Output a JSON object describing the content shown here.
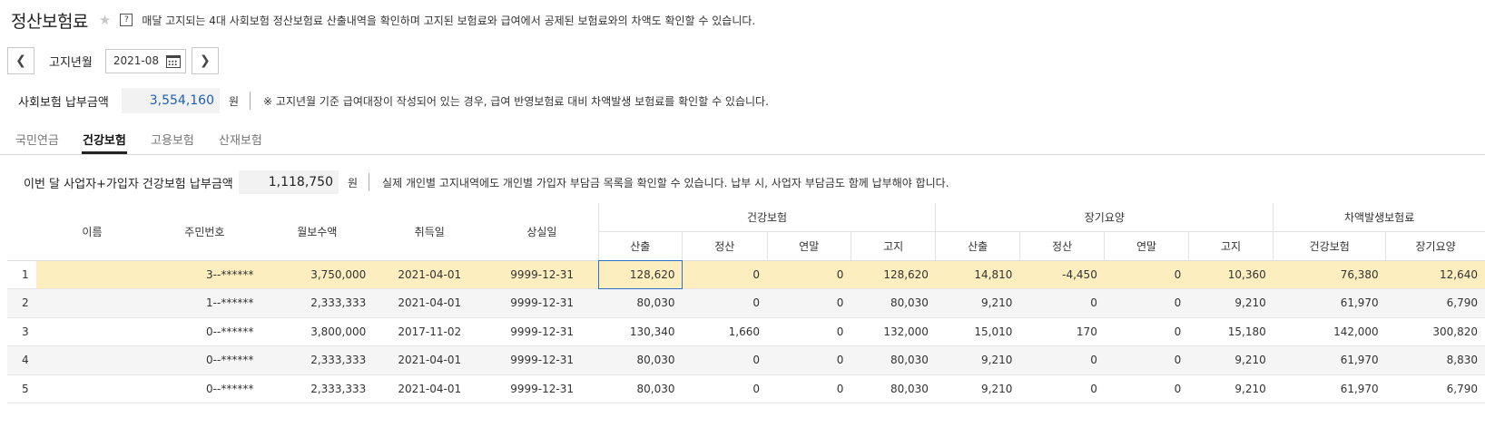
{
  "header": {
    "title": "정산보험료",
    "description": "매달 고지되는 4대 사회보험 정산보험료 산출내역을 확인하며 고지된 보험료와 급여에서 공제된 보험료와의 차액도 확인할 수 있습니다."
  },
  "date_nav": {
    "label": "고지년월",
    "value": "2021-08"
  },
  "total": {
    "label": "사회보험 납부금액",
    "value": "3,554,160",
    "unit": "원",
    "note": "※ 고지년월 기준 급여대장이 작성되어 있는 경우, 급여 반영보험료 대비 차액발생 보험료를 확인할 수 있습니다."
  },
  "tabs": [
    "국민연금",
    "건강보험",
    "고용보험",
    "산재보험"
  ],
  "active_tab": "건강보험",
  "sub_total": {
    "label": "이번 달 사업자+가입자 건강보험 납부금액",
    "value": "1,118,750",
    "unit": "원",
    "note": "실제 개인별 고지내역에도 개인별 가입자 부담금 목록을 확인할 수 있습니다. 납부 시, 사업자 부담금도 함께 납부해야 합니다."
  },
  "table": {
    "columns": {
      "name": "이름",
      "ssn": "주민번호",
      "salary": "월보수액",
      "acquired": "취득일",
      "lost": "상실일",
      "health_group": "건강보험",
      "longterm_group": "장기요양",
      "diff_group": "차액발생보험료",
      "calc": "산출",
      "settle": "정산",
      "yearend": "연말",
      "notice": "고지",
      "diff_health": "건강보험",
      "diff_longterm": "장기요양"
    },
    "rows": [
      {
        "no": "1",
        "name": "",
        "ssn": "3--******",
        "salary": "3,750,000",
        "acquired": "2021-04-01",
        "lost": "9999-12-31",
        "h_calc": "128,620",
        "h_settle": "0",
        "h_year": "0",
        "h_notice": "128,620",
        "l_calc": "14,810",
        "l_settle": "-4,450",
        "l_year": "0",
        "l_notice": "10,360",
        "d_health": "76,380",
        "d_long": "12,640"
      },
      {
        "no": "2",
        "name": "",
        "ssn": "1--******",
        "salary": "2,333,333",
        "acquired": "2021-04-01",
        "lost": "9999-12-31",
        "h_calc": "80,030",
        "h_settle": "0",
        "h_year": "0",
        "h_notice": "80,030",
        "l_calc": "9,210",
        "l_settle": "0",
        "l_year": "0",
        "l_notice": "9,210",
        "d_health": "61,970",
        "d_long": "6,790"
      },
      {
        "no": "3",
        "name": "",
        "ssn": "0--******",
        "salary": "3,800,000",
        "acquired": "2017-11-02",
        "lost": "9999-12-31",
        "h_calc": "130,340",
        "h_settle": "1,660",
        "h_year": "0",
        "h_notice": "132,000",
        "l_calc": "15,010",
        "l_settle": "170",
        "l_year": "0",
        "l_notice": "15,180",
        "d_health": "142,000",
        "d_long": "300,820"
      },
      {
        "no": "4",
        "name": "",
        "ssn": "0--******",
        "salary": "2,333,333",
        "acquired": "2021-04-01",
        "lost": "9999-12-31",
        "h_calc": "80,030",
        "h_settle": "0",
        "h_year": "0",
        "h_notice": "80,030",
        "l_calc": "9,210",
        "l_settle": "0",
        "l_year": "0",
        "l_notice": "9,210",
        "d_health": "61,970",
        "d_long": "8,830"
      },
      {
        "no": "5",
        "name": "",
        "ssn": "0--******",
        "salary": "2,333,333",
        "acquired": "2021-04-01",
        "lost": "9999-12-31",
        "h_calc": "80,030",
        "h_settle": "0",
        "h_year": "0",
        "h_notice": "80,030",
        "l_calc": "9,210",
        "l_settle": "0",
        "l_year": "0",
        "l_notice": "9,210",
        "d_health": "61,970",
        "d_long": "6,790"
      }
    ]
  }
}
